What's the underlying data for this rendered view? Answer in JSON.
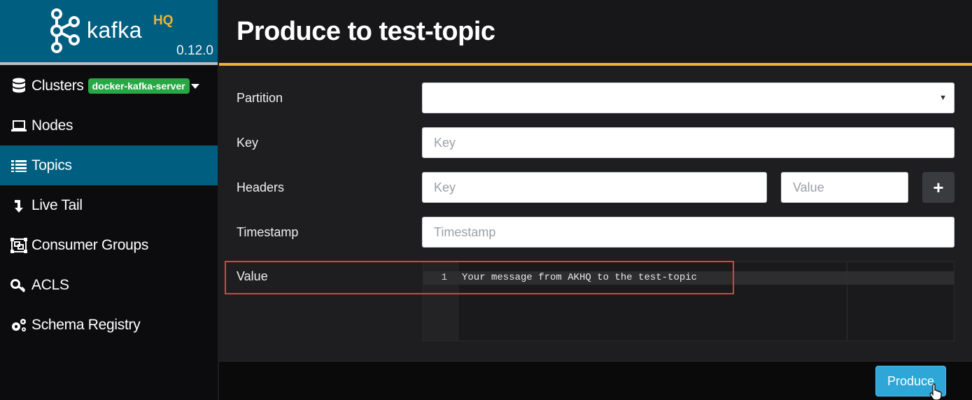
{
  "brand": {
    "name": "kafka",
    "suffix": "HQ",
    "version": "0.12.0"
  },
  "sidebar": {
    "clusters": {
      "label": "Clusters",
      "badge": "docker-kafka-server",
      "icon": "database-icon"
    },
    "items": [
      {
        "label": "Nodes",
        "icon": "laptop-icon",
        "active": false
      },
      {
        "label": "Topics",
        "icon": "list-icon",
        "active": true
      },
      {
        "label": "Live Tail",
        "icon": "arrow-down-icon",
        "active": false
      },
      {
        "label": "Consumer Groups",
        "icon": "object-group-icon",
        "active": false
      },
      {
        "label": "ACLS",
        "icon": "key-icon",
        "active": false
      },
      {
        "label": "Schema Registry",
        "icon": "cogs-icon",
        "active": false
      }
    ]
  },
  "header": {
    "title": "Produce to test-topic"
  },
  "form": {
    "partition": {
      "label": "Partition",
      "value": ""
    },
    "key": {
      "label": "Key",
      "placeholder": "Key"
    },
    "headers": {
      "label": "Headers",
      "key_placeholder": "Key",
      "value_placeholder": "Value",
      "add_label": "+"
    },
    "timestamp": {
      "label": "Timestamp",
      "placeholder": "Timestamp"
    },
    "value": {
      "label": "Value",
      "line_number": "1",
      "code": "Your message from AKHQ to the test-topic"
    }
  },
  "footer": {
    "produce_label": "Produce"
  },
  "colors": {
    "brand": "#005f81",
    "accent": "#ecb431",
    "badge": "#28a745",
    "primary_button": "#2fa6d8",
    "highlight": "#d9414b"
  }
}
